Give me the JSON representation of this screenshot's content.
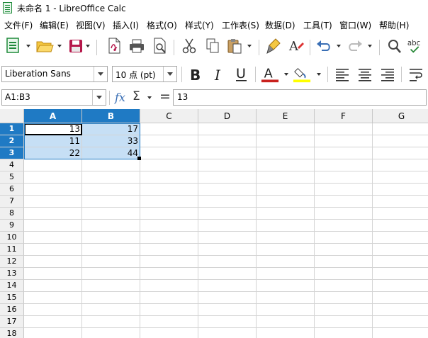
{
  "window": {
    "title": "未命名 1 - LibreOffice Calc"
  },
  "menu": [
    "文件(F)",
    "编辑(E)",
    "视图(V)",
    "插入(I)",
    "格式(O)",
    "样式(Y)",
    "工作表(S)",
    "数据(D)",
    "工具(T)",
    "窗口(W)",
    "帮助(H)"
  ],
  "toolbar": {
    "font_name": "Liberation Sans",
    "font_size": "10 点 (pt)",
    "font_color": "#c9211e",
    "highlight_color": "#ffff00"
  },
  "formula_bar": {
    "name_box": "A1:B3",
    "fx": "fx",
    "sigma": "Σ",
    "equals": "=",
    "content": "13"
  },
  "sheet": {
    "columns": [
      "A",
      "B",
      "C",
      "D",
      "E",
      "F",
      "G"
    ],
    "selected_columns": [
      "A",
      "B"
    ],
    "rows": [
      "1",
      "2",
      "3",
      "4",
      "5",
      "6",
      "7",
      "8",
      "9",
      "10",
      "11",
      "12",
      "13",
      "14",
      "15",
      "16",
      "17",
      "18"
    ],
    "selected_rows": [
      "1",
      "2",
      "3"
    ],
    "cells": {
      "A1": "13",
      "B1": "17",
      "A2": "11",
      "B2": "33",
      "A3": "22",
      "B3": "44"
    },
    "active_cell": "A1",
    "selection": "A1:B3"
  },
  "colors": {
    "selection_header": "#1f7ac4",
    "selection_fill": "#c6dff5"
  }
}
